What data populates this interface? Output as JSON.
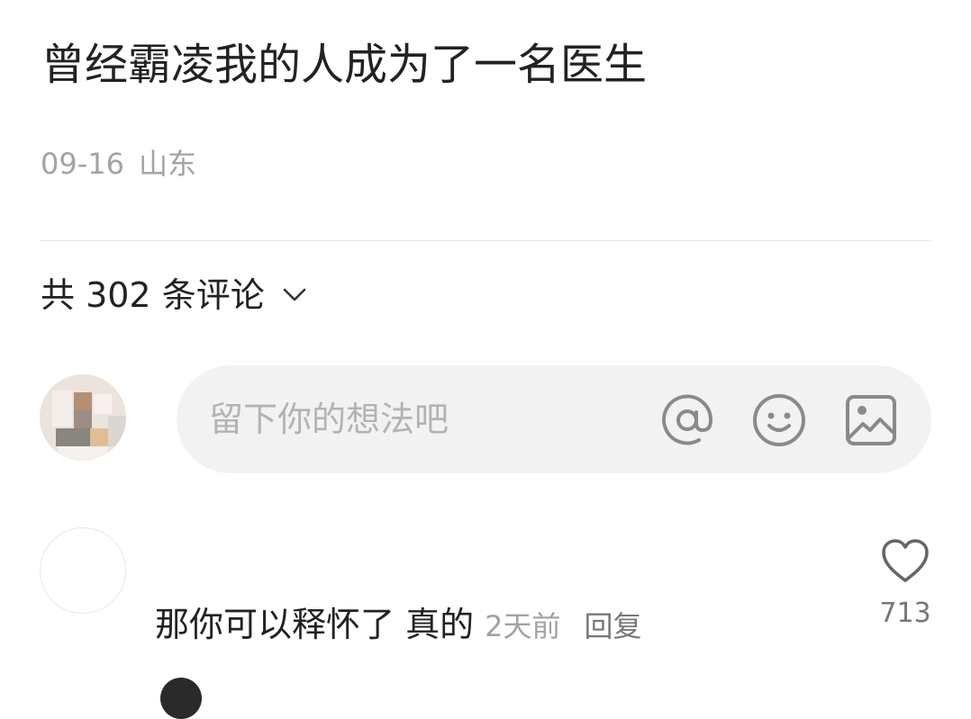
{
  "post": {
    "title": "曾经霸凌我的人成为了一名医生",
    "date": "09-16",
    "location": "山东"
  },
  "comments_header": {
    "label": "共 302 条评论",
    "chevron_icon": "chevron-down-icon"
  },
  "comment_input": {
    "placeholder": "留下你的想法吧",
    "icons": [
      "at-icon",
      "emoji-icon",
      "image-icon"
    ]
  },
  "comments": [
    {
      "text": "那你可以释怀了 真的",
      "time": "2天前",
      "reply_label": "回复",
      "like_count": "713",
      "like_icon": "heart-icon"
    }
  ],
  "colors": {
    "text_primary": "#222222",
    "text_secondary": "#a3a3a3",
    "input_bg": "#f2f2f2",
    "icon_gray": "#8a8a8a"
  }
}
